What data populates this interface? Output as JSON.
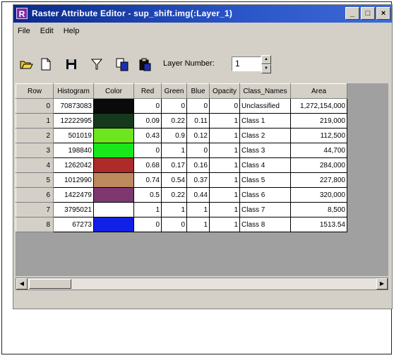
{
  "window": {
    "title": "Raster Attribute Editor - sup_shift.img(:Layer_1)",
    "app_icon_letter": "R",
    "minimize": "_",
    "restore": "□",
    "close": "×"
  },
  "menu": {
    "items": [
      "File",
      "Edit",
      "Help"
    ]
  },
  "toolbar": {
    "icons": [
      "open-folder-icon",
      "new-document-icon",
      "save-icon",
      "filter-icon",
      "copy-icon",
      "paste-icon"
    ],
    "layer_label": "Layer Number:",
    "layer_value": "1",
    "spin_up": "▲",
    "spin_down": "▼"
  },
  "grid": {
    "columns": [
      "Row",
      "Histogram",
      "Color",
      "Red",
      "Green",
      "Blue",
      "Opacity",
      "Class_Names",
      "Area"
    ],
    "rows": [
      {
        "row": "0",
        "histogram": "70873083",
        "color": "#0a0a0a",
        "red": "0",
        "green": "0",
        "blue": "0",
        "opacity": "0",
        "class_name": "Unclassified",
        "area": "1,272,154,000"
      },
      {
        "row": "1",
        "histogram": "12222995",
        "color": "#16391d",
        "red": "0.09",
        "green": "0.22",
        "blue": "0.11",
        "opacity": "1",
        "class_name": "Class 1",
        "area": "219,000"
      },
      {
        "row": "2",
        "histogram": "501019",
        "color": "#6ee61f",
        "red": "0.43",
        "green": "0.9",
        "blue": "0.12",
        "opacity": "1",
        "class_name": "Class 2",
        "area": "112,500"
      },
      {
        "row": "3",
        "histogram": "198840",
        "color": "#18e81a",
        "red": "0",
        "green": "1",
        "blue": "0",
        "opacity": "1",
        "class_name": "Class 3",
        "area": "44,700"
      },
      {
        "row": "4",
        "histogram": "1262042",
        "color": "#ad2b29",
        "red": "0.68",
        "green": "0.17",
        "blue": "0.16",
        "opacity": "1",
        "class_name": "Class 4",
        "area": "284,000"
      },
      {
        "row": "5",
        "histogram": "1012990",
        "color": "#bd8a5e",
        "red": "0.74",
        "green": "0.54",
        "blue": "0.37",
        "opacity": "1",
        "class_name": "Class 5",
        "area": "227,800"
      },
      {
        "row": "6",
        "histogram": "1422479",
        "color": "#7f376f",
        "red": "0.5",
        "green": "0.22",
        "blue": "0.44",
        "opacity": "1",
        "class_name": "Class 6",
        "area": "320,000"
      },
      {
        "row": "7",
        "histogram": "3795021",
        "color": "#ffffff",
        "red": "1",
        "green": "1",
        "blue": "1",
        "opacity": "1",
        "class_name": "Class 7",
        "area": "8,500"
      },
      {
        "row": "8",
        "histogram": "67273",
        "color": "#1020e6",
        "red": "0",
        "green": "0",
        "blue": "1",
        "opacity": "1",
        "class_name": "Class 8",
        "area": "1513.54"
      }
    ]
  },
  "scrollbar": {
    "left": "◀",
    "right": "▶"
  }
}
